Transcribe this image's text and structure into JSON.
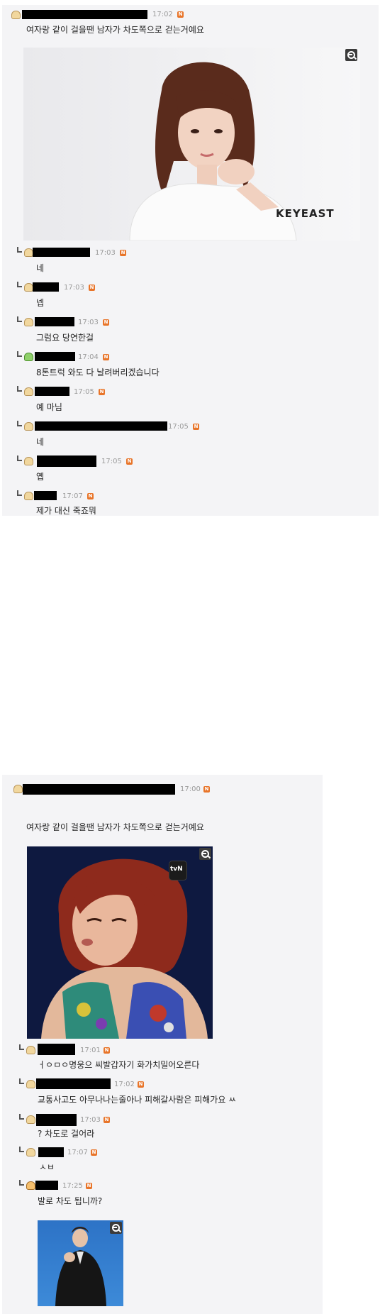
{
  "thread1": {
    "post": {
      "time": "17:02",
      "text": "여자랑 같이 걸을땐 남자가 차도쪽으로 걷는거예요",
      "image_caption": "KEYEAST"
    },
    "replies": [
      {
        "time": "17:03",
        "text": "네"
      },
      {
        "time": "17:03",
        "text": "넵"
      },
      {
        "time": "17:03",
        "text": "그럼요 당연한걸"
      },
      {
        "time": "17:04",
        "text": "8톤트럭 와도 다 날려버리겠습니다"
      },
      {
        "time": "17:05",
        "text": "예 마님"
      },
      {
        "time": "17:05",
        "text": "네"
      },
      {
        "time": "17:05",
        "text": "옙"
      },
      {
        "time": "17:07",
        "text": "제가 대신 죽죠뭐"
      }
    ]
  },
  "thread2": {
    "post": {
      "time": "17:00",
      "text": "여자랑 같이 걸을땐 남자가 차도쪽으로 걷는거예요",
      "image_caption": "tvN"
    },
    "replies": [
      {
        "time": "17:01",
        "text": "ㅓㅇㅁㅇ명웅으 씨발갑자기 화가치밀어오른다"
      },
      {
        "time": "17:02",
        "text": "교통사고도 아무나나는줄아나 피해갈사람은 피해가요 ㅆ"
      },
      {
        "time": "17:03",
        "text": "? 차도로 걸어라"
      },
      {
        "time": "17:07",
        "text": "ㅅㅂ"
      },
      {
        "time": "17:25",
        "text": "발로 차도 됩니까?"
      }
    ]
  },
  "badge_label": "N",
  "colors": {
    "panel_bg": "#f4f4f6",
    "time": "#9a9a9a",
    "badge": "#e8752a"
  }
}
